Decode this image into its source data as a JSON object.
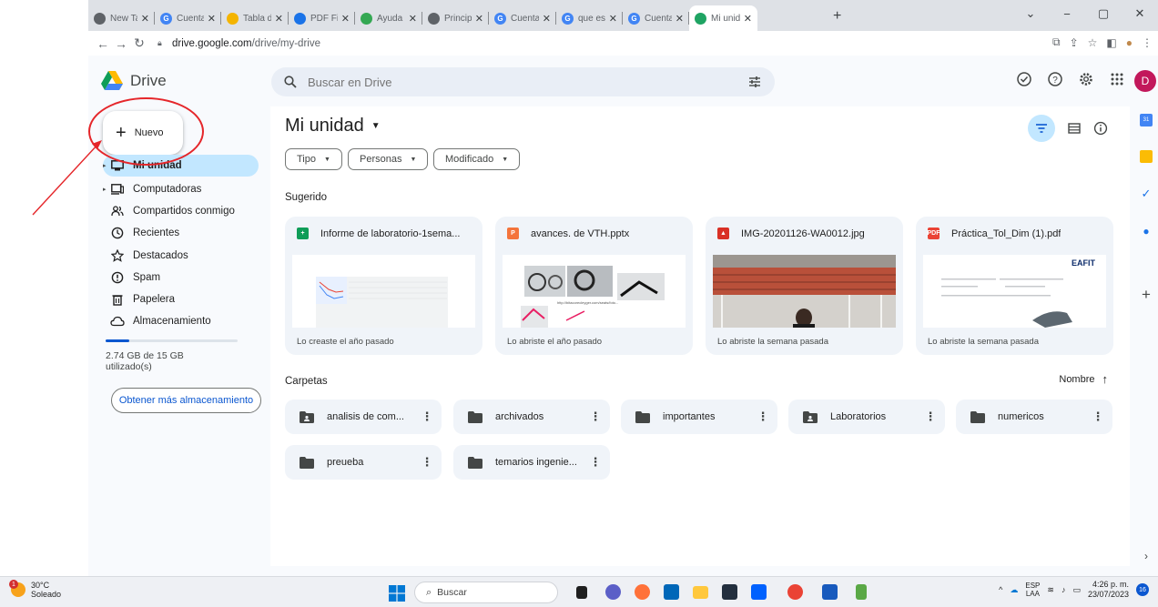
{
  "browser": {
    "tabs": [
      {
        "title": "New Tab",
        "color": "#5f6368",
        "glyph": ""
      },
      {
        "title": "Cuenta de G",
        "color": "#4285f4",
        "glyph": "G"
      },
      {
        "title": "Tabla de co",
        "color": "#f4b400",
        "glyph": ""
      },
      {
        "title": "PDF File vie",
        "color": "#1a73e8",
        "glyph": ""
      },
      {
        "title": "Ayuda de C",
        "color": "#34a853",
        "glyph": ""
      },
      {
        "title": "Principales",
        "color": "#5f6368",
        "glyph": ""
      },
      {
        "title": "Cuenta de G",
        "color": "#4285f4",
        "glyph": "G"
      },
      {
        "title": "que es una",
        "color": "#4285f4",
        "glyph": "G"
      },
      {
        "title": "Cuenta de G",
        "color": "#4285f4",
        "glyph": "G"
      },
      {
        "title": "Mi unidad",
        "color": "#1fa463",
        "glyph": ""
      }
    ],
    "url_host": "drive.google.com",
    "url_path": "/drive/my-drive"
  },
  "header": {
    "logo_text": "Drive",
    "search_placeholder": "Buscar en Drive",
    "avatar_letter": "D"
  },
  "sidebar": {
    "new_label": "Nuevo",
    "items": [
      {
        "label": "Mi unidad",
        "icon": "my-drive-icon",
        "selected": true,
        "caret": true
      },
      {
        "label": "Computadoras",
        "icon": "computer-icon",
        "selected": false,
        "caret": true
      },
      {
        "label": "Compartidos conmigo",
        "icon": "shared-icon",
        "selected": false,
        "caret": false
      },
      {
        "label": "Recientes",
        "icon": "clock-icon",
        "selected": false,
        "caret": false
      },
      {
        "label": "Destacados",
        "icon": "star-icon",
        "selected": false,
        "caret": false
      },
      {
        "label": "Spam",
        "icon": "spam-icon",
        "selected": false,
        "caret": false
      },
      {
        "label": "Papelera",
        "icon": "trash-icon",
        "selected": false,
        "caret": false
      },
      {
        "label": "Almacenamiento",
        "icon": "cloud-icon",
        "selected": false,
        "caret": false
      }
    ],
    "storage_text": "2.74 GB de 15 GB utilizado(s)",
    "storage_fraction": 0.18,
    "get_more": "Obtener más almacenamiento"
  },
  "main": {
    "title": "Mi unidad",
    "filters": [
      "Tipo",
      "Personas",
      "Modificado"
    ],
    "suggested_label": "Sugerido",
    "suggested": [
      {
        "name": "Informe de laboratorio-1sema...",
        "type": "sheets",
        "color": "#0f9d58",
        "subtitle": "Lo creaste el año pasado"
      },
      {
        "name": "avances. de VTH.pptx",
        "type": "slides",
        "color": "#f4743b",
        "subtitle": "Lo abriste el año pasado"
      },
      {
        "name": "IMG-20201126-WA0012.jpg",
        "type": "image",
        "color": "#d93025",
        "subtitle": "Lo abriste la semana pasada"
      },
      {
        "name": "Práctica_Tol_Dim (1).pdf",
        "type": "pdf",
        "color": "#ea4335",
        "subtitle": "Lo abriste la semana pasada"
      }
    ],
    "thumb_text": {
      "pdf_logo": "EAFIT",
      "slides_url": "http://bitacorecleyger.com/seats/foto..."
    },
    "folders_label": "Carpetas",
    "sort_label": "Nombre",
    "folders": [
      {
        "name": "analisis de com...",
        "shared": true
      },
      {
        "name": "archivados",
        "shared": false
      },
      {
        "name": "importantes",
        "shared": false
      },
      {
        "name": "Laboratorios",
        "shared": true
      },
      {
        "name": "numericos",
        "shared": false
      },
      {
        "name": "preueba",
        "shared": false
      },
      {
        "name": "temarios ingenie...",
        "shared": false
      }
    ]
  },
  "taskbar": {
    "temp": "30°C",
    "weather": "Soleado",
    "weather_badge": "1",
    "search": "Buscar",
    "lang_top": "ESP",
    "lang_bottom": "LAA",
    "time": "4:26 p. m.",
    "date": "23/07/2023",
    "notif_count": "16"
  }
}
